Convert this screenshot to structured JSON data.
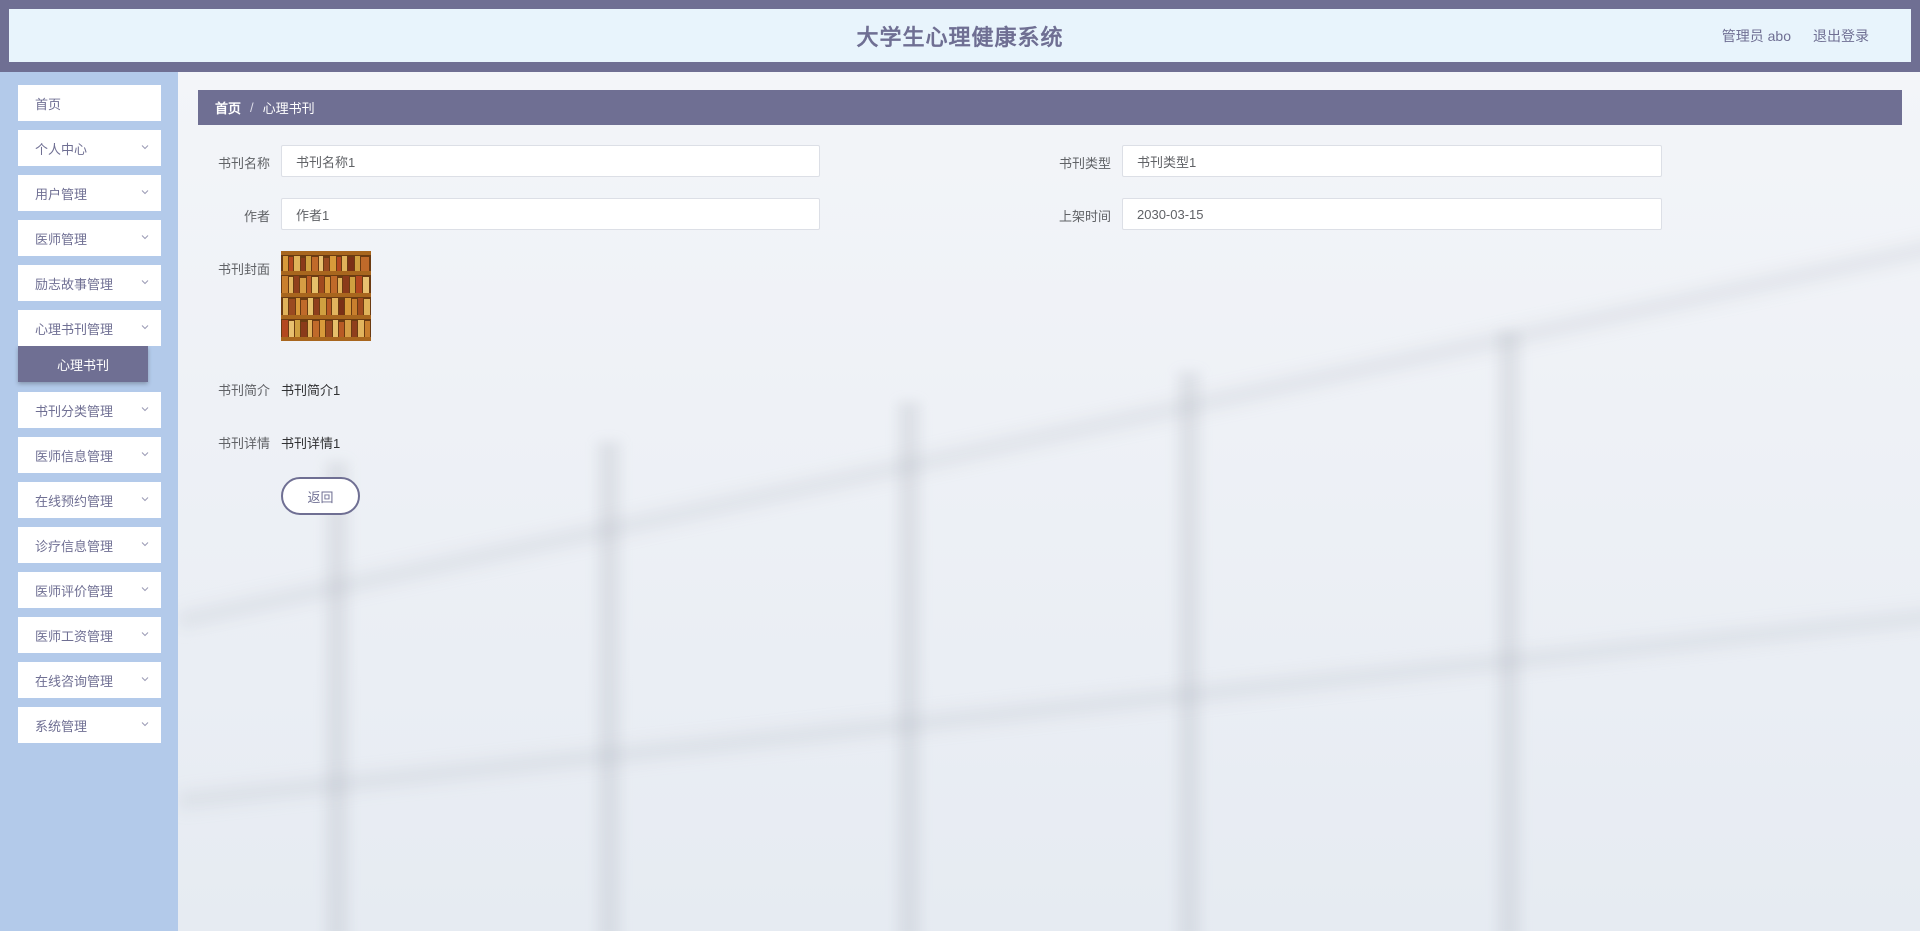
{
  "header": {
    "title": "大学生心理健康系统",
    "user": "管理员 abo",
    "logout": "退出登录"
  },
  "sidebar": {
    "items": [
      {
        "label": "首页",
        "has_children": false
      },
      {
        "label": "个人中心",
        "has_children": true
      },
      {
        "label": "用户管理",
        "has_children": true
      },
      {
        "label": "医师管理",
        "has_children": true
      },
      {
        "label": "励志故事管理",
        "has_children": true
      },
      {
        "label": "心理书刊管理",
        "has_children": true,
        "expanded": true
      },
      {
        "label": "书刊分类管理",
        "has_children": true
      },
      {
        "label": "医师信息管理",
        "has_children": true
      },
      {
        "label": "在线预约管理",
        "has_children": true
      },
      {
        "label": "诊疗信息管理",
        "has_children": true
      },
      {
        "label": "医师评价管理",
        "has_children": true
      },
      {
        "label": "医师工资管理",
        "has_children": true
      },
      {
        "label": "在线咨询管理",
        "has_children": true
      },
      {
        "label": "系统管理",
        "has_children": true
      }
    ],
    "active_sub": "心理书刊"
  },
  "breadcrumb": {
    "home": "首页",
    "separator": "/",
    "current": "心理书刊"
  },
  "form": {
    "name_label": "书刊名称",
    "name_value": "书刊名称1",
    "type_label": "书刊类型",
    "type_value": "书刊类型1",
    "author_label": "作者",
    "author_value": "作者1",
    "date_label": "上架时间",
    "date_value": "2030-03-15",
    "cover_label": "书刊封面",
    "intro_label": "书刊简介",
    "intro_value": "书刊简介1",
    "detail_label": "书刊详情",
    "detail_value": "书刊详情1",
    "back_button": "返回"
  },
  "colors": {
    "accent": "#6f6f93",
    "sidebar_bg": "#b3caea",
    "header_bg": "#e8f4fc"
  }
}
